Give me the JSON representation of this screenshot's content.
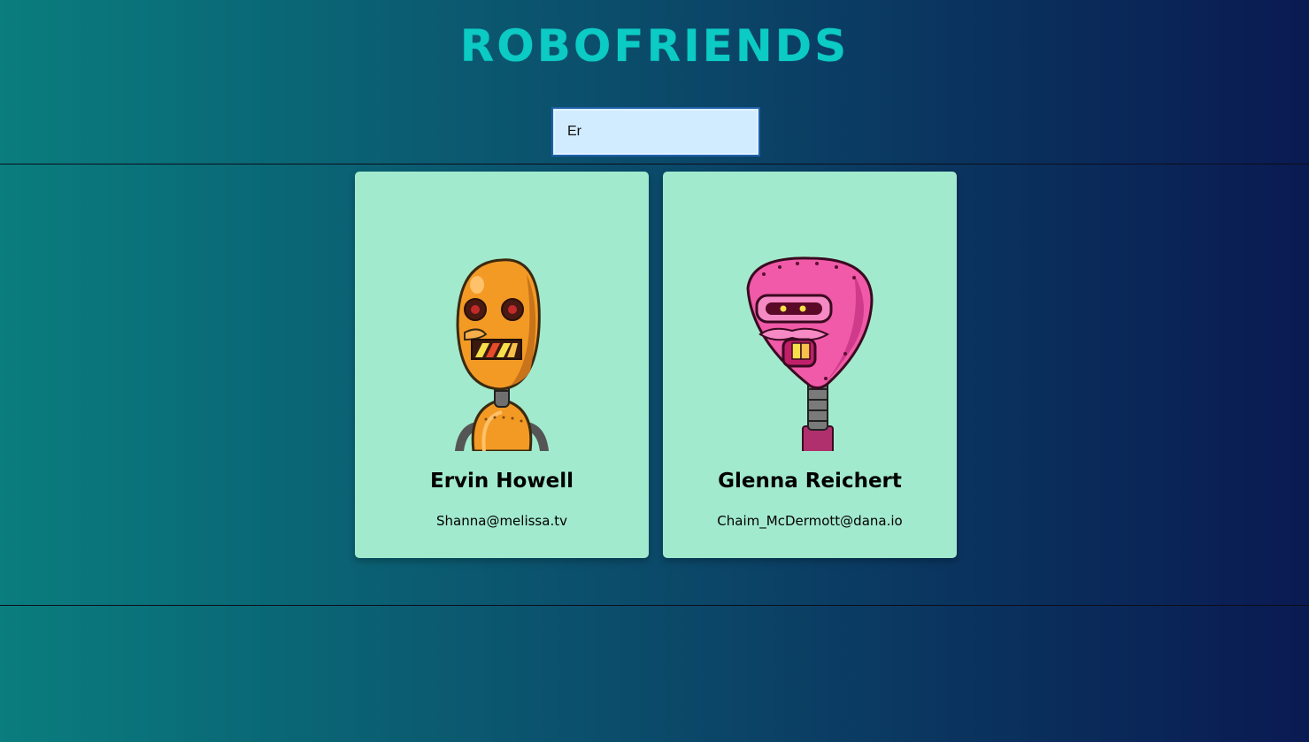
{
  "app": {
    "title": "ROBOFRIENDS"
  },
  "search": {
    "value": "Er"
  },
  "colors": {
    "background_left": "#0a7d7e",
    "background_right": "#0a1a52",
    "logo": "#0ccac4",
    "card": "#a2eace",
    "search_bg": "#d2ecff"
  },
  "robots": [
    {
      "name": "Ervin Howell",
      "email": "Shanna@melissa.tv",
      "image_icon": "orange-robot-icon"
    },
    {
      "name": "Glenna Reichert",
      "email": "Chaim_McDermott@dana.io",
      "image_icon": "pink-robot-icon"
    }
  ]
}
